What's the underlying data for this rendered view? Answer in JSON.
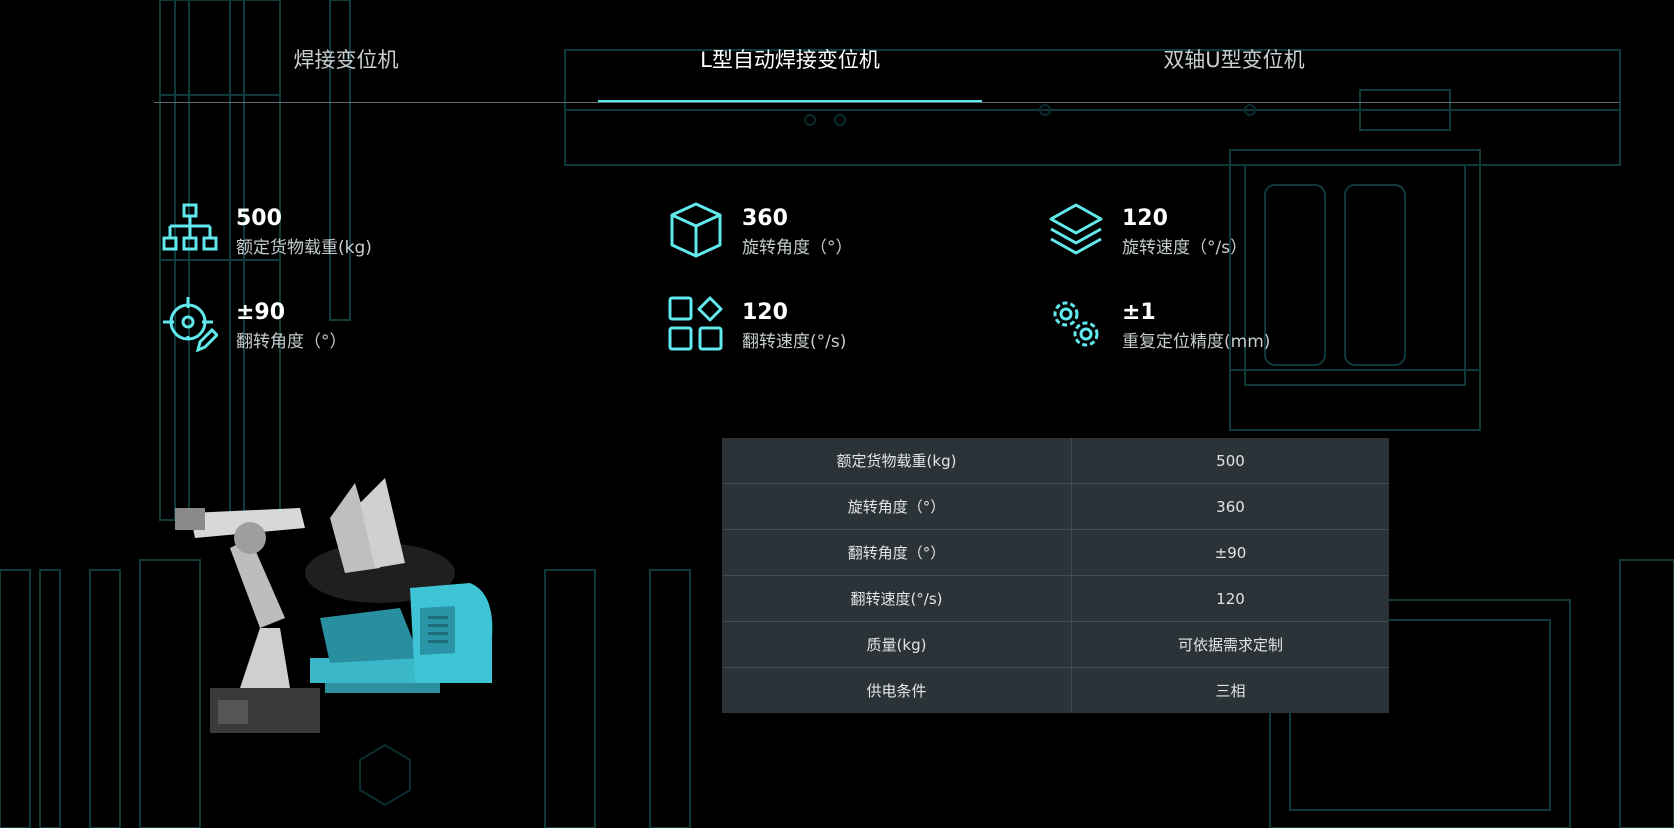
{
  "tabs": [
    {
      "label": "焊接变位机",
      "active": false
    },
    {
      "label": "L型自动焊接变位机",
      "active": true
    },
    {
      "label": "双轴U型变位机",
      "active": false
    }
  ],
  "stats": [
    {
      "value": "500",
      "label": "额定货物载重(kg)",
      "icon": "org-chart-icon"
    },
    {
      "value": "360",
      "label": "旋转角度（°）",
      "icon": "cube-icon"
    },
    {
      "value": "120",
      "label": "旋转速度（°/s）",
      "icon": "layers-icon"
    },
    {
      "value": "±90",
      "label": "翻转角度（°）",
      "icon": "target-edit-icon"
    },
    {
      "value": "120",
      "label": "翻转速度(°/s)",
      "icon": "grid-diamond-icon"
    },
    {
      "value": "±1",
      "label": "重复定位精度(mm)",
      "icon": "gears-icon"
    }
  ],
  "spec_table": [
    {
      "name": "额定货物载重(kg)",
      "value": "500"
    },
    {
      "name": "旋转角度（°）",
      "value": "360"
    },
    {
      "name": "翻转角度（°）",
      "value": "±90"
    },
    {
      "name": "翻转速度(°/s)",
      "value": "120"
    },
    {
      "name": "质量(kg)",
      "value": "可依据需求定制"
    },
    {
      "name": "供电条件",
      "value": "三相"
    }
  ],
  "colors": {
    "accent": "#62e9ee",
    "table_bg": "#2b3339",
    "background": "#000000"
  }
}
